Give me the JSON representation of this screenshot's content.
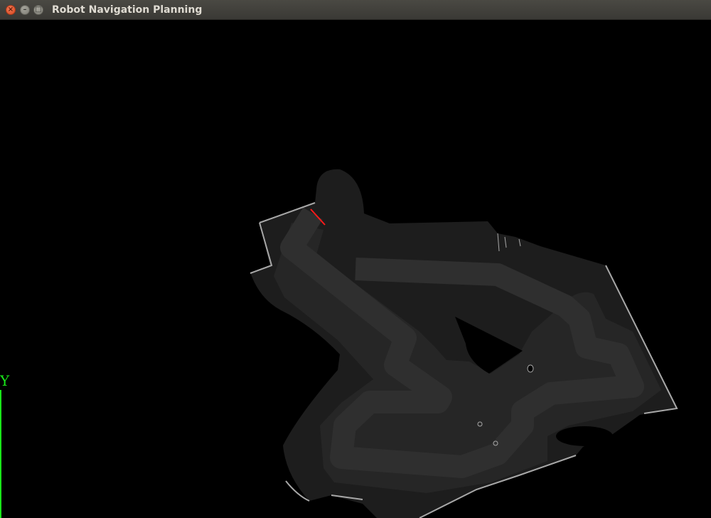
{
  "window": {
    "title": "Robot Navigation Planning",
    "controls": {
      "close": "×",
      "minimize": "–",
      "maximize": "□"
    }
  },
  "viewport": {
    "y_axis_label": "Y",
    "colors": {
      "background": "#000000",
      "free_space": "#1d1d1d",
      "inflation_zone": "#262626",
      "planned_path": "#2f2f2f",
      "wall_outline": "#a8a8a8",
      "robot_heading": "#ff1a1a",
      "y_axis": "#19e619"
    }
  }
}
